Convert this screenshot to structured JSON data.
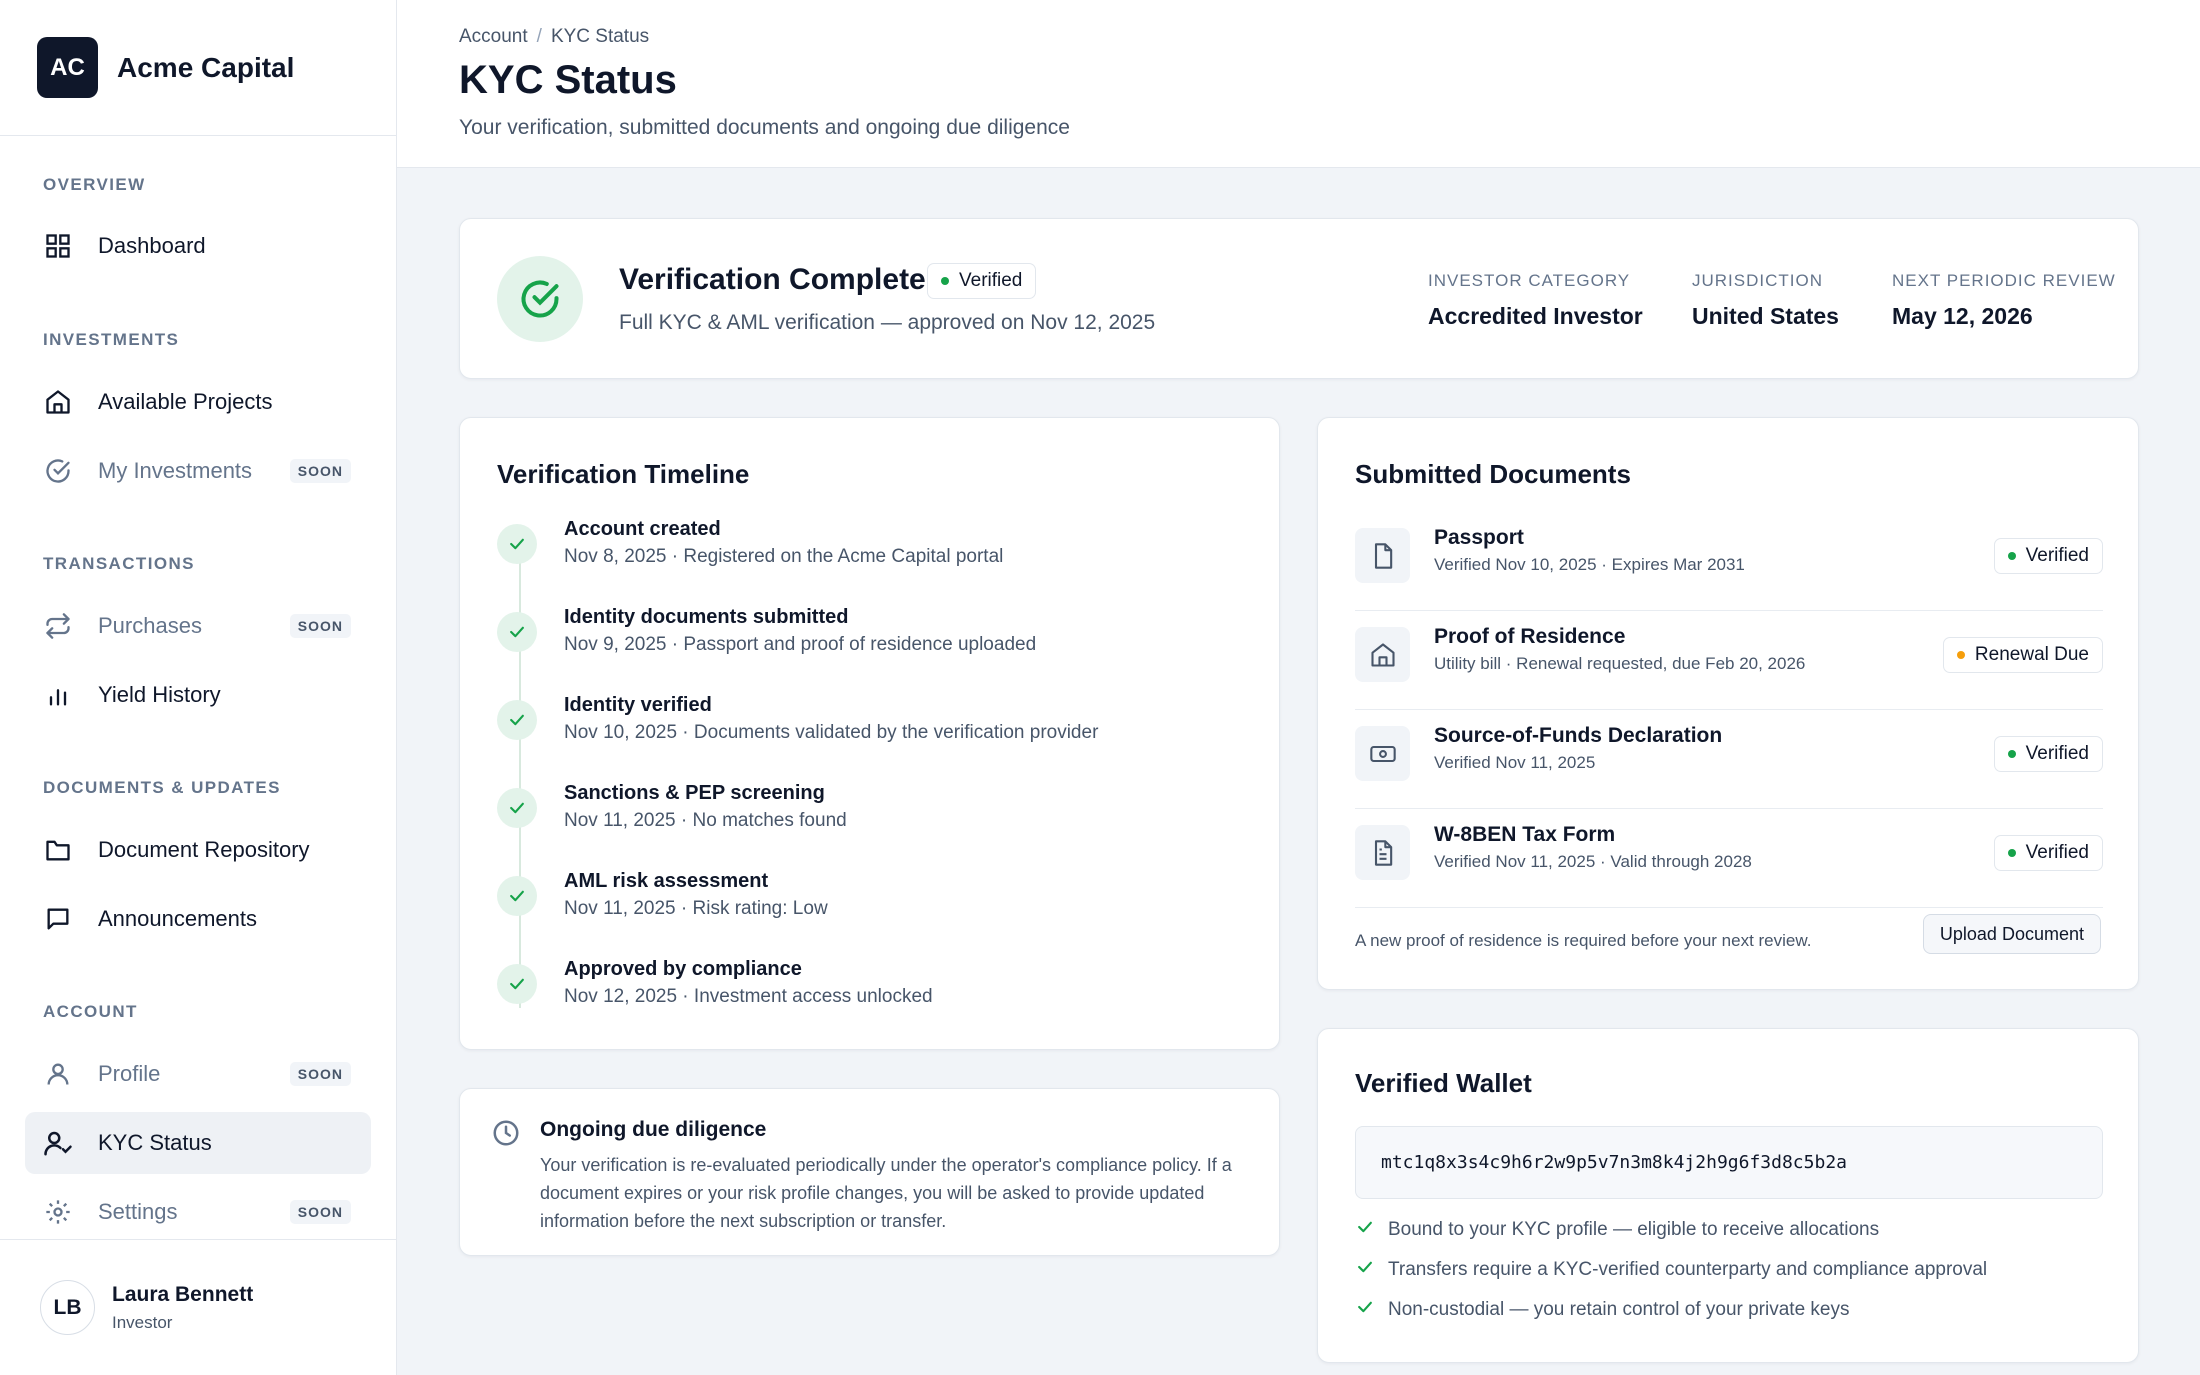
{
  "brand": {
    "logo": "AC",
    "name": "Acme Capital"
  },
  "sidebar": {
    "sections": [
      "OVERVIEW",
      "INVESTMENTS",
      "TRANSACTIONS",
      "DOCUMENTS & UPDATES",
      "ACCOUNT"
    ],
    "items": [
      {
        "label": "Dashboard",
        "icon": "grid-icon",
        "badge": ""
      },
      {
        "label": "Available Projects",
        "icon": "home-icon",
        "badge": ""
      },
      {
        "label": "My Investments",
        "icon": "check-circle-icon",
        "badge": "SOON"
      },
      {
        "label": "Purchases",
        "icon": "swap-icon",
        "badge": "SOON"
      },
      {
        "label": "Yield History",
        "icon": "bar-chart-icon",
        "badge": ""
      },
      {
        "label": "Document Repository",
        "icon": "folder-icon",
        "badge": ""
      },
      {
        "label": "Announcements",
        "icon": "message-icon",
        "badge": ""
      },
      {
        "label": "Profile",
        "icon": "user-icon",
        "badge": "SOON"
      },
      {
        "label": "KYC Status",
        "icon": "user-check-icon",
        "badge": ""
      },
      {
        "label": "Settings",
        "icon": "gear-icon",
        "badge": "SOON"
      }
    ],
    "active": "KYC Status"
  },
  "user": {
    "initials": "LB",
    "name": "Laura Bennett",
    "role": "Investor"
  },
  "header": {
    "breadcrumb": [
      "Account",
      "KYC Status"
    ],
    "title": "KYC Status",
    "subtitle": "Your verification, submitted documents and ongoing due diligence"
  },
  "status": {
    "title": "Verification Complete",
    "badge": "Verified",
    "subtitle": "Full KYC & AML verification — approved on Nov 12, 2025",
    "fields": [
      {
        "label": "INVESTOR CATEGORY",
        "value": "Accredited Investor"
      },
      {
        "label": "JURISDICTION",
        "value": "United States"
      },
      {
        "label": "NEXT PERIODIC REVIEW",
        "value": "May 12, 2026"
      }
    ]
  },
  "timeline": {
    "title": "Verification Timeline",
    "steps": [
      {
        "title": "Account created",
        "desc": "Nov 8, 2025 · Registered on the Acme Capital portal"
      },
      {
        "title": "Identity documents submitted",
        "desc": "Nov 9, 2025 · Passport and proof of residence uploaded"
      },
      {
        "title": "Identity verified",
        "desc": "Nov 10, 2025 · Documents validated by the verification provider"
      },
      {
        "title": "Sanctions & PEP screening",
        "desc": "Nov 11, 2025 · No matches found"
      },
      {
        "title": "AML risk assessment",
        "desc": "Nov 11, 2025 · Risk rating: Low"
      },
      {
        "title": "Approved by compliance",
        "desc": "Nov 12, 2025 · Investment access unlocked"
      }
    ]
  },
  "documents": {
    "title": "Submitted Documents",
    "items": [
      {
        "name": "Passport",
        "meta": "Verified Nov 10, 2025 · Expires Mar 2031",
        "status": "Verified",
        "icon": "file-icon"
      },
      {
        "name": "Proof of Residence",
        "meta": "Utility bill · Renewal requested, due Feb 20, 2026",
        "status": "Renewal Due",
        "icon": "home-icon"
      },
      {
        "name": "Source-of-Funds Declaration",
        "meta": "Verified Nov 11, 2025",
        "status": "Verified",
        "icon": "banknote-icon"
      },
      {
        "name": "W-8BEN Tax Form",
        "meta": "Verified Nov 11, 2025 · Valid through 2028",
        "status": "Verified",
        "icon": "file-text-icon"
      }
    ],
    "note": "A new proof of residence is required before your next review.",
    "upload_label": "Upload Document"
  },
  "due_diligence": {
    "title": "Ongoing due diligence",
    "text": "Your verification is re-evaluated periodically under the operator's compliance policy. If a document expires or your risk profile changes, you will be asked to provide updated information before the next subscription or transfer."
  },
  "wallet": {
    "title": "Verified Wallet",
    "address": "mtc1q8x3s4c9h6r2w9p5v7n3m8k4j2h9g6f3d8c5b2a",
    "points": [
      "Bound to your KYC profile — eligible to receive allocations",
      "Transfers require a KYC-verified counterparty and compliance approval",
      "Non-custodial — you retain control of your private keys"
    ]
  },
  "colors": {
    "success": "#16a34a",
    "warning": "#f59e0b",
    "dark": "#0f172a",
    "muted": "#475569"
  }
}
